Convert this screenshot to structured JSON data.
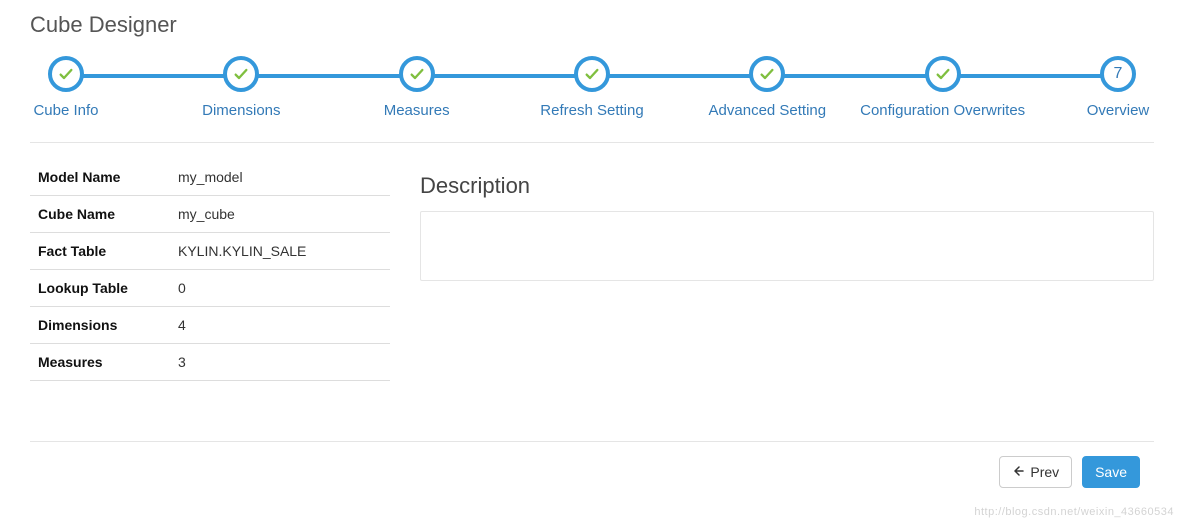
{
  "title": "Cube Designer",
  "steps": [
    {
      "label": "Cube Info",
      "done": true
    },
    {
      "label": "Dimensions",
      "done": true
    },
    {
      "label": "Measures",
      "done": true
    },
    {
      "label": "Refresh Setting",
      "done": true
    },
    {
      "label": "Advanced Setting",
      "done": true
    },
    {
      "label": "Configuration Overwrites",
      "done": true
    },
    {
      "label": "Overview",
      "done": false,
      "number": "7"
    }
  ],
  "details": {
    "rows": [
      {
        "k": "Model Name",
        "v": "my_model"
      },
      {
        "k": "Cube Name",
        "v": "my_cube"
      },
      {
        "k": "Fact Table",
        "v": "KYLIN.KYLIN_SALE"
      },
      {
        "k": "Lookup Table",
        "v": "0"
      },
      {
        "k": "Dimensions",
        "v": "4"
      },
      {
        "k": "Measures",
        "v": "3"
      }
    ],
    "description_label": "Description",
    "description_value": ""
  },
  "footer": {
    "prev_label": "Prev",
    "save_label": "Save"
  },
  "watermark": "http://blog.csdn.net/weixin_43660534"
}
